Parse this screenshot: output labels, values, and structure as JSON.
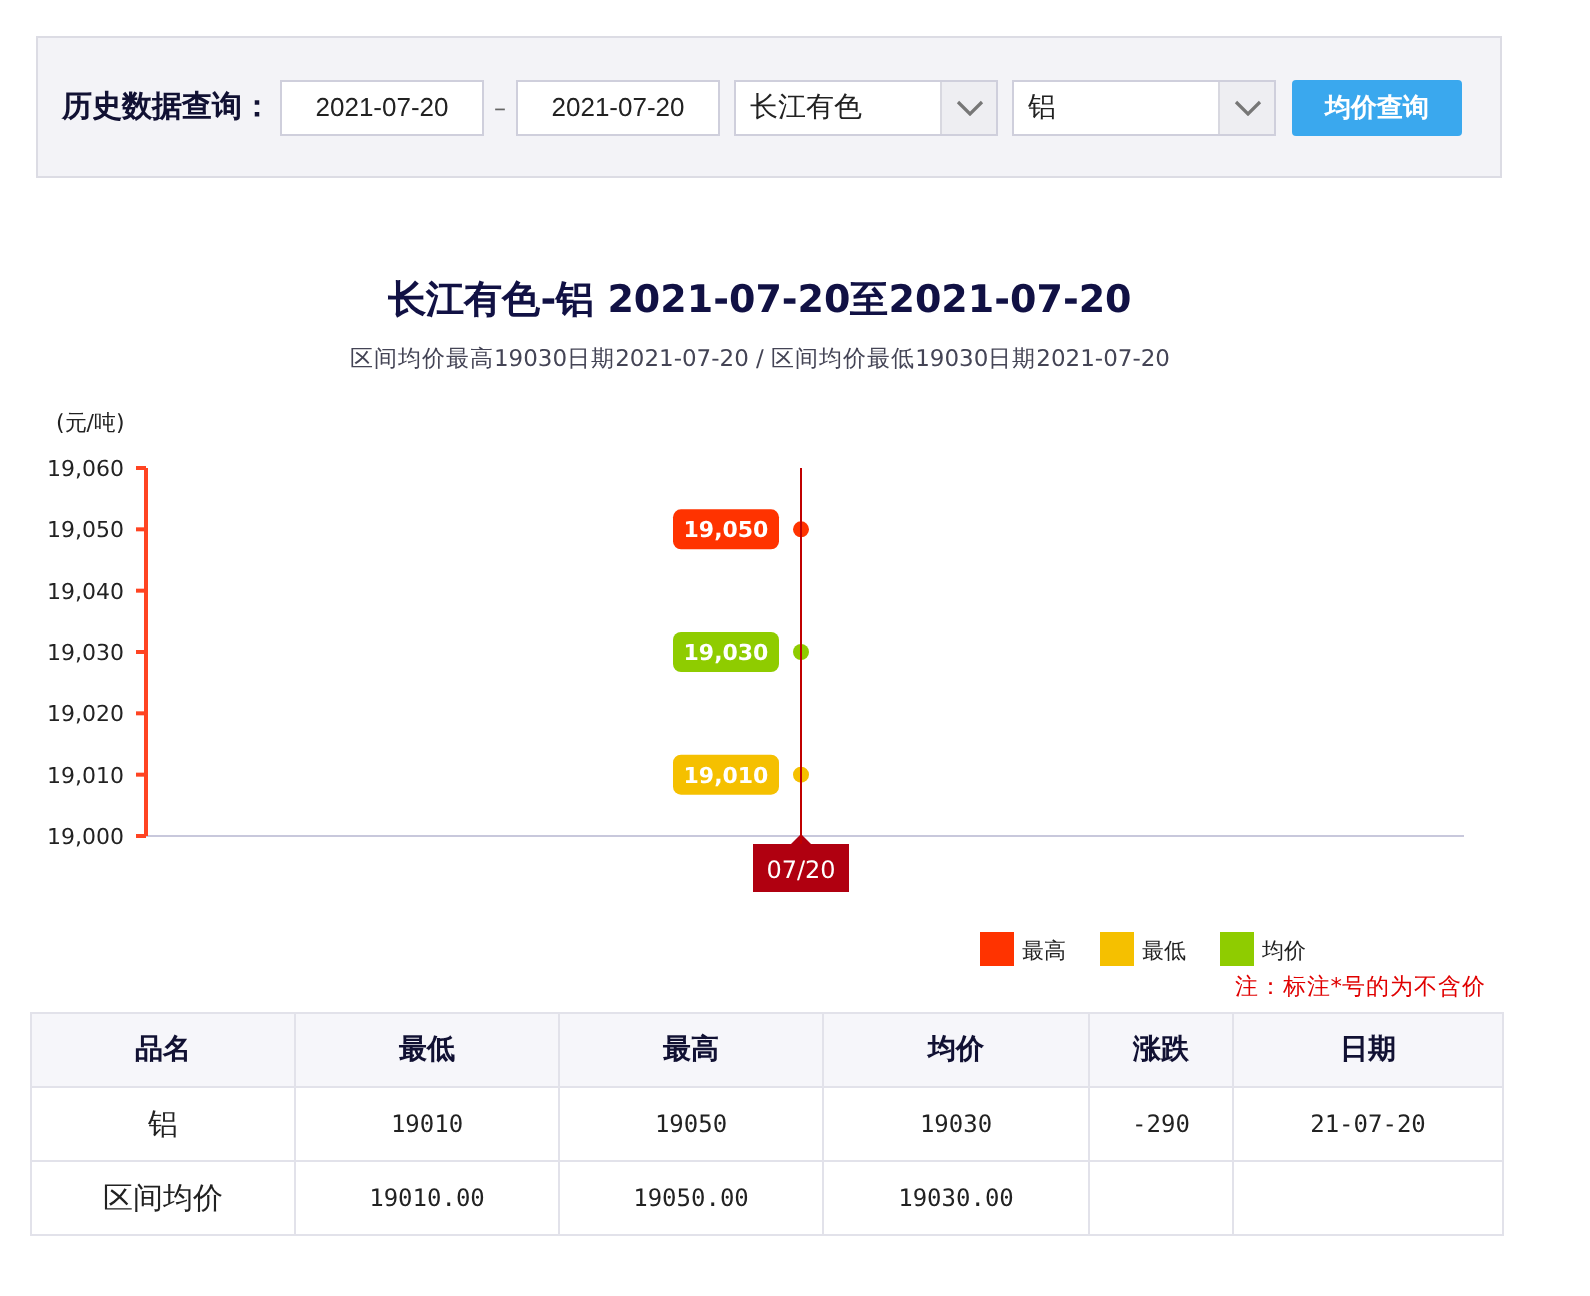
{
  "query": {
    "label": "历史数据查询：",
    "start_date": "2021-07-20",
    "separator": "–",
    "end_date": "2021-07-20",
    "market": "长江有色",
    "metal": "铝",
    "button": "均价查询"
  },
  "heading": {
    "title": "长江有色-铝 2021-07-20至2021-07-20",
    "subtitle": "区间均价最高19030日期2021-07-20 / 区间均价最低19030日期2021-07-20"
  },
  "chart_data": {
    "type": "scatter",
    "ylabel": "(元/吨)",
    "categories": [
      "07/20"
    ],
    "series": [
      {
        "name": "最高",
        "color": "#ff3300",
        "values": [
          19050
        ],
        "value_labels": [
          "19,050"
        ]
      },
      {
        "name": "最低",
        "color": "#f5c000",
        "values": [
          19010
        ],
        "value_labels": [
          "19,010"
        ]
      },
      {
        "name": "均价",
        "color": "#8fcc00",
        "values": [
          19030
        ],
        "value_labels": [
          "19,030"
        ]
      }
    ],
    "legend": true,
    "ref_lines": [
      {
        "axis": "x",
        "value": "07/20",
        "color": "#c00000"
      }
    ],
    "ylim": [
      19000,
      19060
    ],
    "yticks": [
      {
        "value": 19000,
        "label": "19,000"
      },
      {
        "value": 19010,
        "label": "19,010"
      },
      {
        "value": 19020,
        "label": "19,020"
      },
      {
        "value": 19030,
        "label": "19,030"
      },
      {
        "value": 19040,
        "label": "19,040"
      },
      {
        "value": 19050,
        "label": "19,050"
      },
      {
        "value": 19060,
        "label": "19,060"
      }
    ],
    "data_labels": true
  },
  "note": "注：标注*号的为不含价",
  "table": {
    "columns": [
      "品名",
      "最低",
      "最高",
      "均价",
      "涨跌",
      "日期"
    ],
    "rows": [
      [
        "铝",
        "19010",
        "19050",
        "19030",
        "-290",
        "21-07-20"
      ],
      [
        "区间均价",
        "19010.00",
        "19050.00",
        "19030.00",
        "",
        ""
      ]
    ]
  }
}
